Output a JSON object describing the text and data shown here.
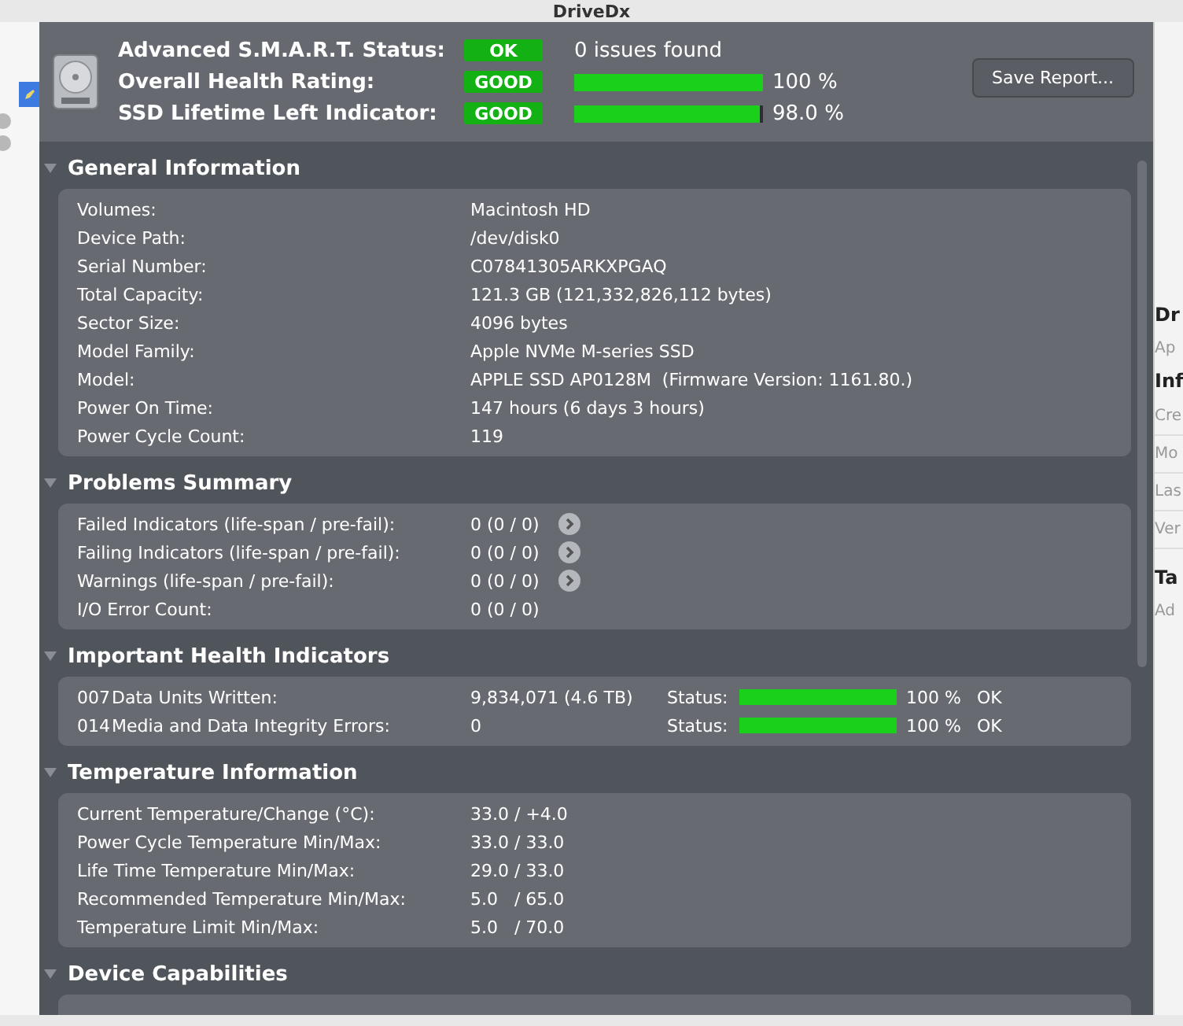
{
  "window": {
    "title": "DriveDx"
  },
  "sidebar": {
    "items": [
      {
        "kind": "pen",
        "selected": true
      },
      {
        "kind": "dot",
        "selected": false
      },
      {
        "kind": "dot",
        "selected": false
      }
    ]
  },
  "header": {
    "rows": [
      {
        "label": "Advanced S.M.A.R.T. Status:",
        "badge": "OK",
        "text": "0 issues found"
      },
      {
        "label": "Overall Health Rating:",
        "badge": "GOOD",
        "level": 1.0,
        "reading": "100 %"
      },
      {
        "label": "SSD Lifetime Left Indicator:",
        "badge": "GOOD",
        "level": 0.98,
        "reading": "98.0 %"
      }
    ],
    "save_button": "Save Report..."
  },
  "sections": [
    {
      "title": "General Information",
      "expanded": true,
      "kind": "plain",
      "rows": [
        {
          "label": "Volumes:",
          "value": "Macintosh HD"
        },
        {
          "label": "Device Path:",
          "value": "/dev/disk0"
        },
        {
          "label": "Serial Number:",
          "value": "C07841305ARKXPGAQ"
        },
        {
          "label": "Total Capacity:",
          "value": "121.3 GB (121,332,826,112 bytes)"
        },
        {
          "label": "Sector Size:",
          "value": "4096 bytes"
        },
        {
          "label": "Model Family:",
          "value": "Apple NVMe M-series SSD"
        },
        {
          "label": "Model:",
          "value": "APPLE SSD AP0128M  (Firmware Version: 1161.80.)"
        },
        {
          "label": "Power On Time:",
          "value": "147 hours (6 days 3 hours)"
        },
        {
          "label": "Power Cycle Count:",
          "value": "119"
        }
      ]
    },
    {
      "title": "Problems Summary",
      "expanded": true,
      "kind": "plain",
      "rows": [
        {
          "label": "Failed Indicators (life-span / pre-fail):",
          "value": "0 (0 / 0)",
          "link": true
        },
        {
          "label": "Failing Indicators (life-span / pre-fail):",
          "value": "0 (0 / 0)",
          "link": true
        },
        {
          "label": "Warnings (life-span / pre-fail):",
          "value": "0 (0 / 0)",
          "link": true
        },
        {
          "label": "I/O Error Count:",
          "value": "0 (0 / 0)",
          "link": false
        }
      ]
    },
    {
      "title": "Important Health Indicators",
      "expanded": true,
      "kind": "status",
      "rows": [
        {
          "id": "007",
          "label": "Data Units Written:",
          "value": "9,834,071 (4.6 TB)",
          "status_label": "Status:",
          "level": 1.0,
          "reading": "100 %",
          "status": "OK"
        },
        {
          "id": "014",
          "label": "Media and Data Integrity Errors:",
          "value": "0",
          "status_label": "Status:",
          "level": 1.0,
          "reading": "100 %",
          "status": "OK"
        }
      ]
    },
    {
      "title": "Temperature Information",
      "expanded": true,
      "kind": "plain",
      "rows": [
        {
          "label": "Current Temperature/Change (°C):",
          "value": "33.0 / +4.0"
        },
        {
          "label": "Power Cycle Temperature Min/Max:",
          "value": "33.0 / 33.0"
        },
        {
          "label": "Life Time Temperature Min/Max:",
          "value": "29.0 / 33.0"
        },
        {
          "label": "Recommended Temperature Min/Max:",
          "value": "5.0   / 65.0"
        },
        {
          "label": "Temperature Limit Min/Max:",
          "value": "5.0   / 70.0"
        }
      ]
    },
    {
      "title": "Device Capabilities",
      "expanded": true
    }
  ],
  "side_panel": {
    "items": [
      {
        "text": "Dr",
        "kind": "heading"
      },
      {
        "text": "Ap",
        "kind": "sub"
      },
      {
        "text": "Inf",
        "kind": "heading"
      },
      {
        "text": "Cre",
        "kind": "row"
      },
      {
        "text": "Mo",
        "kind": "row"
      },
      {
        "text": "Las",
        "kind": "row"
      },
      {
        "text": "Ver",
        "kind": "row"
      },
      {
        "text": "Ta",
        "kind": "heading"
      },
      {
        "text": "Ad",
        "kind": "placeholder"
      }
    ]
  }
}
